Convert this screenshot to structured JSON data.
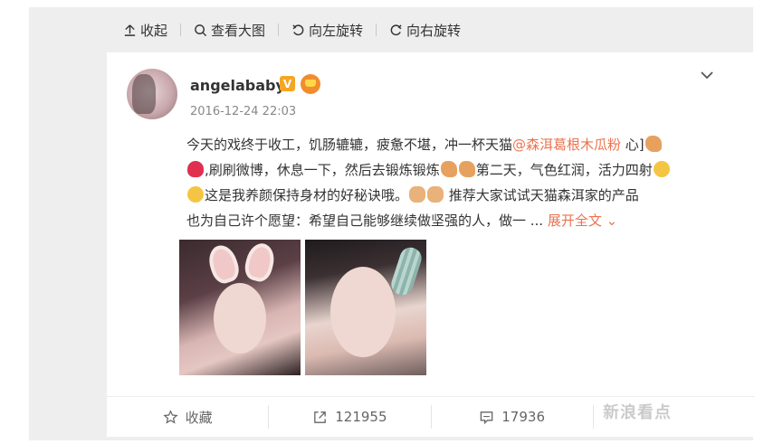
{
  "toolbar": {
    "items": [
      {
        "label": "收起",
        "icon": "collapse-up-icon"
      },
      {
        "label": "查看大图",
        "icon": "search-icon"
      },
      {
        "label": "向左旋转",
        "icon": "rotate-left-icon"
      },
      {
        "label": "向右旋转",
        "icon": "rotate-right-icon"
      }
    ]
  },
  "post": {
    "username": "angelababy",
    "verified_badge": "V",
    "timestamp": "2016-12-24 22:03",
    "text": {
      "line1_a": "今天的戏终于收工，饥肠辘辘，疲惫不堪，冲一杯天猫",
      "mention": "@森洱葛根木瓜粉",
      "line1_b": " 心]",
      "line2_a": ",刷刷微博，休息一下，然后去锻炼锻炼",
      "line2_b": "第二天，气色红润，活力四射",
      "line3_a": "这是我养颜保持身材的好秘诀哦。",
      "line3_b": " 推荐大家试试天猫森洱家的产品",
      "line4": "也为自己许个愿望：希望自己能够继续做坚强的人，做一 ... ",
      "expand": "展开全文"
    },
    "photos": [
      "photo-bunny-ears-selfie",
      "photo-hair-clip-selfie"
    ]
  },
  "actions": {
    "favorite": "收藏",
    "repost_count": "121955",
    "comment_count": "17936"
  },
  "watermark": "新浪看点",
  "colors": {
    "accent": "#eb7350",
    "frame": "#eeeeee",
    "text": "#333333",
    "muted": "#888888"
  }
}
